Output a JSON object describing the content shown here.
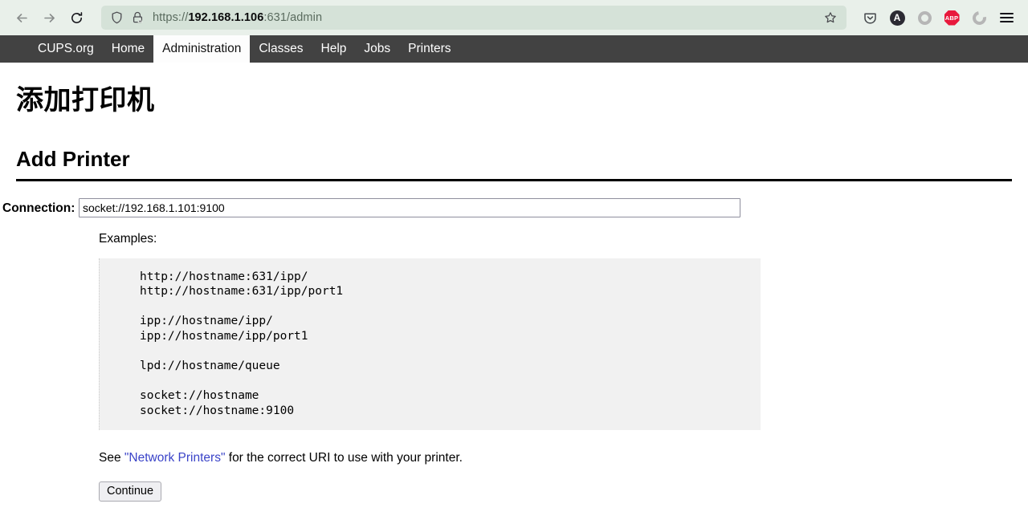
{
  "browser": {
    "back_icon": "back-arrow-icon",
    "forward_icon": "forward-arrow-icon",
    "reload_icon": "reload-icon",
    "shield_icon": "shield-icon",
    "lock_warning_icon": "lock-warning-icon",
    "url_scheme": "https://",
    "url_host": "192.168.1.106",
    "url_path": ":631/admin",
    "url_full": "https://192.168.1.106:631/admin",
    "bookmark_icon": "bookmark-star-icon",
    "extensions": [
      {
        "name": "pocket-icon",
        "label": ""
      },
      {
        "name": "account-icon",
        "label": "A"
      },
      {
        "name": "extension-ring-icon",
        "label": ""
      },
      {
        "name": "adblock-plus-icon",
        "label": "ABP"
      },
      {
        "name": "extension-partial-ring-icon",
        "label": ""
      }
    ],
    "menu_icon": "hamburger-menu-icon",
    "toolbar_bg": "#e9f0ea",
    "urlbar_bg": "#d5e2d8"
  },
  "cups_nav": {
    "items": [
      {
        "label": "CUPS.org",
        "active": false
      },
      {
        "label": "Home",
        "active": false
      },
      {
        "label": "Administration",
        "active": true
      },
      {
        "label": "Classes",
        "active": false
      },
      {
        "label": "Help",
        "active": false
      },
      {
        "label": "Jobs",
        "active": false
      },
      {
        "label": "Printers",
        "active": false
      }
    ],
    "bg": "#424242",
    "active_bg": "#fdfdfd"
  },
  "page": {
    "title_zh": "添加打印机",
    "title_en": "Add Printer",
    "connection_label": "Connection:",
    "connection_value": "socket://192.168.1.101:9100",
    "connection_placeholder": "",
    "examples_label": "Examples:",
    "examples_text": "http://hostname:631/ipp/\nhttp://hostname:631/ipp/port1\n\nipp://hostname/ipp/\nipp://hostname/ipp/port1\n\nlpd://hostname/queue\n\nsocket://hostname\nsocket://hostname:9100",
    "examples_lines": [
      "http://hostname:631/ipp/",
      "http://hostname:631/ipp/port1",
      "",
      "ipp://hostname/ipp/",
      "ipp://hostname/ipp/port1",
      "",
      "lpd://hostname/queue",
      "",
      "socket://hostname",
      "socket://hostname:9100"
    ],
    "see_prefix": "See ",
    "see_link": "\"Network Printers\"",
    "see_suffix": " for the correct URI to use with your printer.",
    "continue_label": "Continue",
    "link_color": "#3a43c8"
  }
}
